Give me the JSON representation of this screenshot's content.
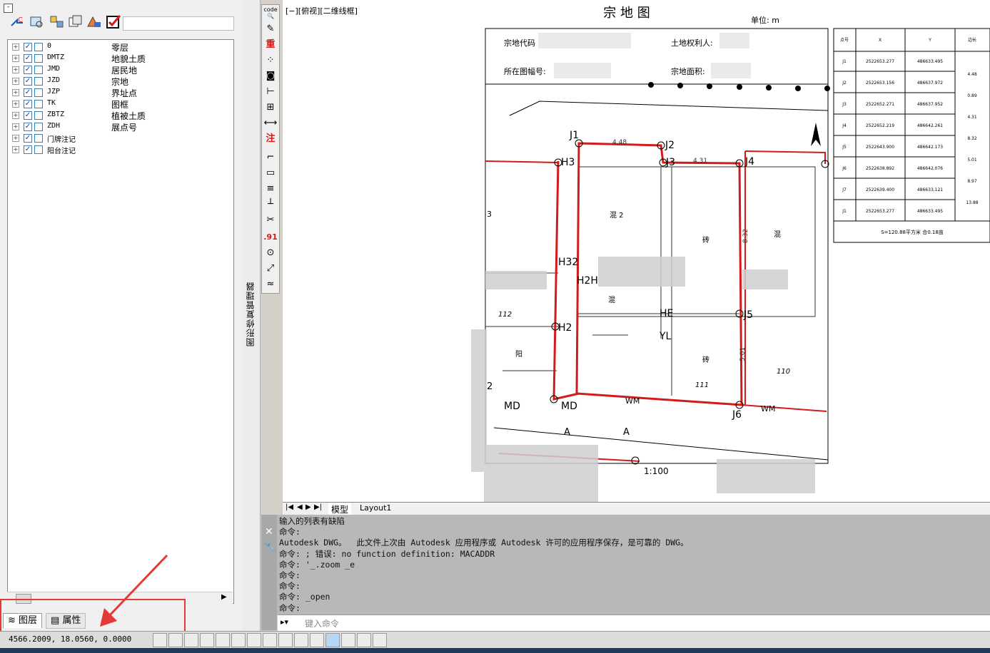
{
  "left_panel": {
    "minimize": "-",
    "layers": [
      {
        "code": "0",
        "name": "零层"
      },
      {
        "code": "DMTZ",
        "name": "地貌土质"
      },
      {
        "code": "JMD",
        "name": "居民地"
      },
      {
        "code": "JZD",
        "name": "宗地"
      },
      {
        "code": "JZP",
        "name": "界址点"
      },
      {
        "code": "TK",
        "name": "图框"
      },
      {
        "code": "ZBTZ",
        "name": "植被土质"
      },
      {
        "code": "ZDH",
        "name": "展点号"
      },
      {
        "code": "门牌注记",
        "name": ""
      },
      {
        "code": "阳台注记",
        "name": ""
      }
    ],
    "tabs": {
      "layer": "图层",
      "attributes": "属性"
    },
    "vertical_title": "图形修复管理器"
  },
  "vtoolbar": {
    "items": [
      "code",
      "重",
      "注",
      ".91"
    ]
  },
  "drawing": {
    "viewport_label": "[−][俯视][二维线框]",
    "title": "宗 地 图",
    "unit": "单位: m",
    "fields": {
      "parcel_code": "宗地代码",
      "owner": "土地权利人:",
      "sheet_no": "所在图幅号:",
      "area": "宗地面积:"
    },
    "scale": "1:100",
    "point_labels": [
      "J1",
      "J2",
      "J3",
      "J4",
      "J5",
      "J6",
      "H3",
      "H2",
      "H32",
      "H2H",
      "HE",
      "YL",
      "MD",
      "WM"
    ],
    "building_labels": [
      "混 2",
      "砖",
      "混",
      "混",
      "阳",
      "砖",
      "111",
      "110",
      "112"
    ],
    "dim_labels": [
      "4.48",
      "4.31",
      "8.32",
      "5.01"
    ],
    "coord_table": {
      "headers": [
        "点号",
        "X",
        "Y",
        "边长"
      ],
      "rows": [
        {
          "pt": "J1",
          "x": "2522653.277",
          "y": "486633.495",
          "len": ""
        },
        {
          "pt": "J2",
          "x": "2522653.156",
          "y": "486637.972",
          "len": "4.48"
        },
        {
          "pt": "J3",
          "x": "2522652.271",
          "y": "486637.952",
          "len": "0.89"
        },
        {
          "pt": "J4",
          "x": "2522652.219",
          "y": "486642.261",
          "len": "4.31"
        },
        {
          "pt": "J5",
          "x": "2522643.900",
          "y": "486642.173",
          "len": "8.32"
        },
        {
          "pt": "J6",
          "x": "2522638.892",
          "y": "486642.076",
          "len": "5.01"
        },
        {
          "pt": "J7",
          "x": "2522639.400",
          "y": "486633.121",
          "len": "8.97"
        },
        {
          "pt": "J1",
          "x": "2522653.277",
          "y": "486633.495",
          "len": "13.88"
        }
      ],
      "footer": "S=120.88平方米 合0.18亩"
    },
    "misc_labels": [
      "A",
      "A",
      "3",
      "2"
    ]
  },
  "model_tabs": {
    "model": "模型",
    "layout": "Layout1"
  },
  "command": {
    "lines": [
      "输入的列表有缺陷",
      "命令:",
      "Autodesk DWG。  此文件上次由 Autodesk 应用程序或 Autodesk 许可的应用程序保存，是可靠的 DWG。",
      "命令: ; 错误: no function definition: MACADDR",
      "命令: '_.zoom _e",
      "命令:",
      "命令:",
      "命令: _open",
      "命令:"
    ],
    "placeholder": "键入命令"
  },
  "statusbar": {
    "coords": "4566.2009,  18.0560,  0.0000"
  }
}
